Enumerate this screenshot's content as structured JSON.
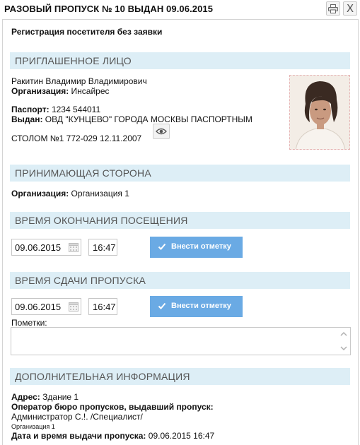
{
  "header": {
    "title": "РАЗОВЫЙ ПРОПУСК № 10 ВЫДАН 09.06.2015",
    "print_icon": "printer-icon",
    "close_icon": "close-icon",
    "close_glyph": "X"
  },
  "subtitle": "Регистрация посетителя без заявки",
  "invited": {
    "section_title": "ПРИГЛАШЕННОЕ ЛИЦО",
    "full_name": "Ракитин  Владимир  Владимирович",
    "org_label": "Организация:",
    "org_value": "Инсайрес",
    "passport_label": "Паспорт:",
    "passport_value": "1234  544011",
    "issued_label": "Выдан:",
    "issued_value": "ОВД \"КУНЦЕВО\" ГОРОДА МОСКВЫ ПАСПОРТНЫМ",
    "issued_value_2": "СТОЛОМ №1 772-029  12.11.2007",
    "eye_icon": "eye-icon"
  },
  "host": {
    "section_title": "ПРИНИМАЮЩАЯ СТОРОНА",
    "org_label": "Организация:",
    "org_value": "Организация 1"
  },
  "visit_end": {
    "section_title": "ВРЕМЯ ОКОНЧАНИЯ ПОСЕЩЕНИЯ",
    "date": "09.06.2015",
    "time": "16:47",
    "button_label": "Внести отметку"
  },
  "pass_return": {
    "section_title": "ВРЕМЯ СДАЧИ ПРОПУСКА",
    "date": "09.06.2015",
    "time": "16:47",
    "button_label": "Внести отметку"
  },
  "notes": {
    "label": "Пометки:",
    "value": ""
  },
  "extra": {
    "section_title": "ДОПОЛНИТЕЛЬНАЯ ИНФОРМАЦИЯ",
    "address_label": "Адрес:",
    "address_value": "Здание 1",
    "operator_label": "Оператор бюро пропусков, выдавший пропуск:",
    "operator_value": "Администратор С.!. /Специалист/",
    "operator_org": "Организация 1",
    "issued_dt_label": "Дата и время выдачи пропуска:",
    "issued_dt_value": "09.06.2015 16:47"
  },
  "colors": {
    "section_bar": "#ddeef6",
    "section_text": "#555555",
    "button_bg": "#6aaae4",
    "photo_border": "#e6b4b4"
  }
}
